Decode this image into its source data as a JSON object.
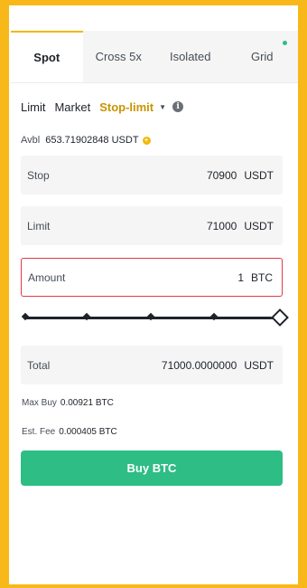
{
  "tabs": [
    {
      "label": "Spot",
      "active": true
    },
    {
      "label": "Cross 5x",
      "active": false
    },
    {
      "label": "Isolated",
      "active": false
    },
    {
      "label": "Grid",
      "active": false,
      "has_dot": true
    }
  ],
  "order_types": {
    "limit": "Limit",
    "market": "Market",
    "stop_limit": "Stop-limit",
    "selected": "Stop-limit"
  },
  "available": {
    "label": "Avbl",
    "value": "653.71902848 USDT"
  },
  "stop": {
    "label": "Stop",
    "value": "70900",
    "unit": "USDT"
  },
  "limit": {
    "label": "Limit",
    "value": "71000",
    "unit": "USDT"
  },
  "amount": {
    "label": "Amount",
    "value": "1",
    "unit": "BTC"
  },
  "slider": {
    "percent": 100
  },
  "total": {
    "label": "Total",
    "value": "71000.0000000",
    "unit": "USDT"
  },
  "max_buy": {
    "label": "Max Buy",
    "value": "0.00921 BTC"
  },
  "est_fee": {
    "label": "Est. Fee",
    "value": "0.000405 BTC"
  },
  "buy_button": {
    "label": "Buy BTC"
  },
  "colors": {
    "accent": "#F0B90B",
    "active_order_type": "#C99400",
    "buy": "#2EBD85",
    "error_border": "#E0394A",
    "frame": "#F9B81A"
  }
}
